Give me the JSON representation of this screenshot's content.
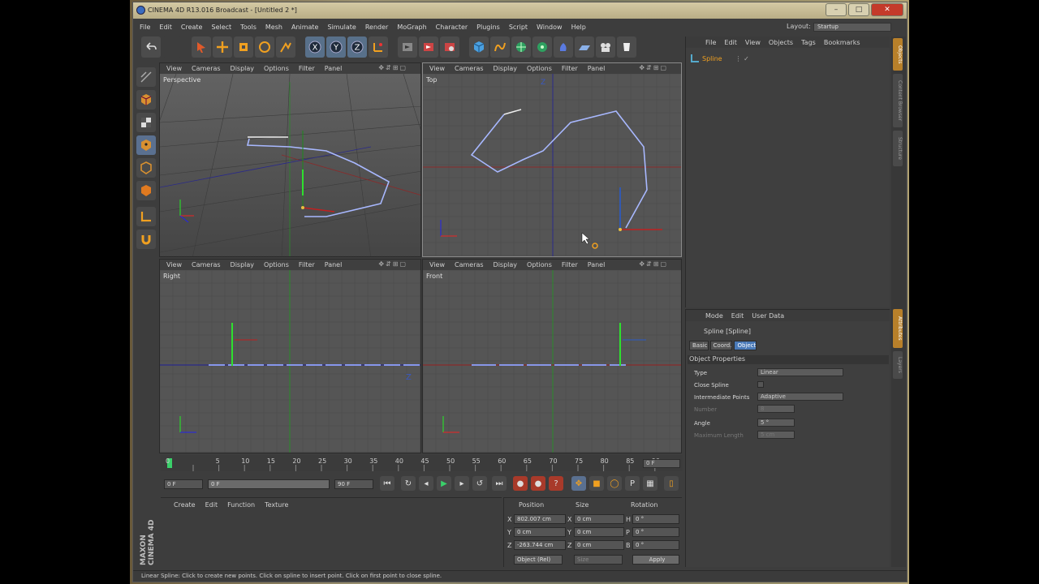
{
  "window": {
    "title": "CINEMA 4D R13.016 Broadcast - [Untitled 2 *]",
    "controls": [
      "–",
      "□",
      "✕"
    ]
  },
  "menubar": [
    "File",
    "Edit",
    "Create",
    "Select",
    "Tools",
    "Mesh",
    "Animate",
    "Simulate",
    "Render",
    "MoGraph",
    "Character",
    "Plugins",
    "Script",
    "Window",
    "Help"
  ],
  "layout": {
    "label": "Layout:",
    "value": "Startup"
  },
  "toolbar": {
    "icons": [
      "undo-icon",
      "redo-icon",
      "live-select-icon",
      "move-icon",
      "scale-icon",
      "rotate-icon",
      "recent-tool-icon",
      "x-axis-icon",
      "y-axis-icon",
      "z-axis-icon",
      "coordinate-system-icon",
      "render-view-icon",
      "render-picture-viewer-icon",
      "render-settings-icon",
      "cube-icon",
      "spline-pen-icon",
      "subdivision-icon",
      "array-icon",
      "deformer-icon",
      "floor-icon",
      "camera-icon",
      "light-icon"
    ],
    "axis_labels": [
      "X",
      "Y",
      "Z"
    ]
  },
  "viewports": [
    {
      "name": "Perspective",
      "menu": [
        "View",
        "Cameras",
        "Display",
        "Options",
        "Filter",
        "Panel"
      ]
    },
    {
      "name": "Top",
      "menu": [
        "View",
        "Cameras",
        "Display",
        "Options",
        "Filter",
        "Panel"
      ],
      "axis_label": "Z"
    },
    {
      "name": "Right",
      "menu": [
        "View",
        "Cameras",
        "Display",
        "Options",
        "Filter",
        "Panel"
      ],
      "axis_label": "Z"
    },
    {
      "name": "Front",
      "menu": [
        "View",
        "Cameras",
        "Display",
        "Options",
        "Filter",
        "Panel"
      ]
    }
  ],
  "timeline": {
    "ticks": [
      "0",
      "5",
      "10",
      "15",
      "20",
      "25",
      "30",
      "35",
      "40",
      "45",
      "50",
      "55",
      "60",
      "65",
      "70",
      "75",
      "80",
      "85",
      "90"
    ],
    "current_frame": "0 F",
    "start": "0 F",
    "range_start": "0 F",
    "range_end": "90 F",
    "end": "90 F"
  },
  "material_manager": {
    "menu": [
      "Create",
      "Edit",
      "Function",
      "Texture"
    ]
  },
  "coordinates": {
    "headers": [
      "Position",
      "Size",
      "Rotation"
    ],
    "rows": [
      {
        "axis": "X",
        "position": "802.007 cm",
        "size_axis": "X",
        "size": "0 cm",
        "rot_axis": "H",
        "rotation": "0 °"
      },
      {
        "axis": "Y",
        "position": "0 cm",
        "size_axis": "Y",
        "size": "0 cm",
        "rot_axis": "P",
        "rotation": "0 °"
      },
      {
        "axis": "Z",
        "position": "-263.744 cm",
        "size_axis": "Z",
        "size": "0 cm",
        "rot_axis": "B",
        "rotation": "0 °"
      }
    ],
    "mode": "Object (Rel)",
    "size_mode": "Size",
    "apply": "Apply"
  },
  "object_manager": {
    "menu": [
      "File",
      "Edit",
      "View",
      "Objects",
      "Tags",
      "Bookmarks"
    ],
    "objects": [
      {
        "name": "Spline"
      }
    ]
  },
  "attribute_manager": {
    "menu": [
      "Mode",
      "Edit",
      "User Data"
    ],
    "object_title": "Spline [Spline]",
    "tabs": [
      "Basic",
      "Coord.",
      "Object"
    ],
    "active_tab": "Object",
    "section": "Object Properties",
    "fields": [
      {
        "label": "Type",
        "value": "Linear"
      },
      {
        "label": "Close Spline",
        "value": ""
      },
      {
        "label": "Intermediate Points",
        "value": "Adaptive"
      },
      {
        "label": "Number",
        "value": "8"
      },
      {
        "label": "Angle",
        "value": "5 °"
      },
      {
        "label": "Maximum Length",
        "value": "5 cm"
      }
    ]
  },
  "side_tabs": [
    "Objects",
    "Content Browser",
    "Structure",
    "Attributes",
    "Layers"
  ],
  "brand": "MAXON CINEMA 4D",
  "status": "Linear Spline: Click to create new points. Click on spline to insert point. Click on first point to close spline."
}
